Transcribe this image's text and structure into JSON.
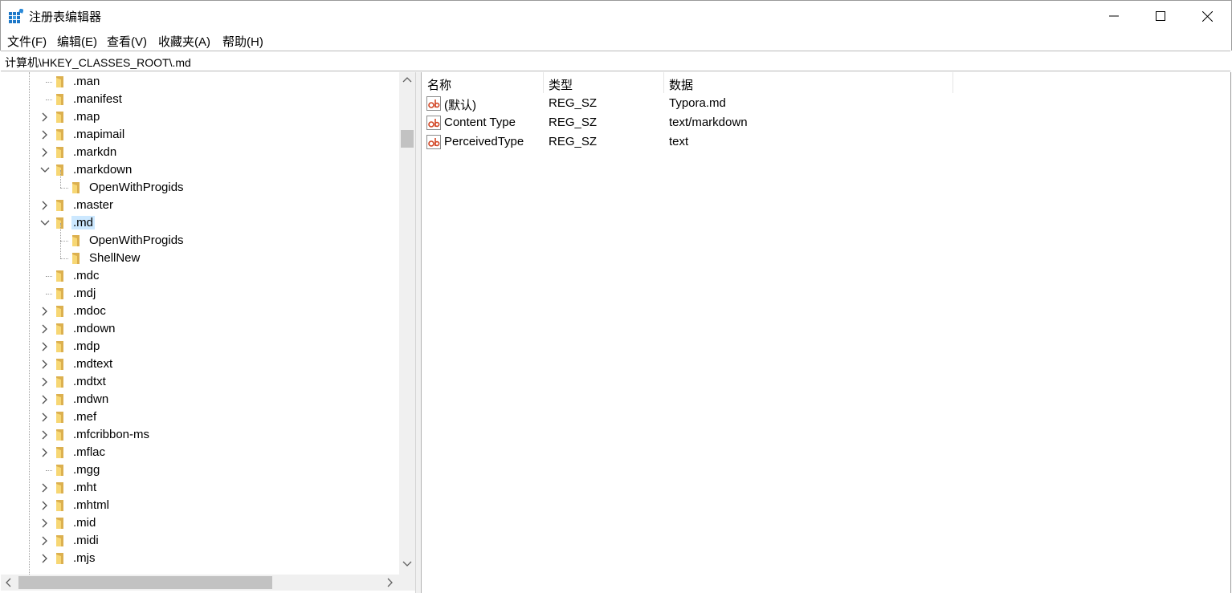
{
  "window": {
    "title": "注册表编辑器"
  },
  "menu": [
    "文件(F)",
    "编辑(E)",
    "查看(V)",
    "收藏夹(A)",
    "帮助(H)"
  ],
  "address": "计算机\\HKEY_CLASSES_ROOT\\.md",
  "tree": {
    "rows": [
      {
        "label": ".man",
        "expander": "none",
        "level": 1
      },
      {
        "label": ".manifest",
        "expander": "none",
        "level": 1
      },
      {
        "label": ".map",
        "expander": "collapsed",
        "level": 1
      },
      {
        "label": ".mapimail",
        "expander": "collapsed",
        "level": 1
      },
      {
        "label": ".markdn",
        "expander": "collapsed",
        "level": 1
      },
      {
        "label": ".markdown",
        "expander": "expanded",
        "level": 1
      },
      {
        "label": "OpenWithProgids",
        "expander": "none",
        "level": 2
      },
      {
        "label": ".master",
        "expander": "collapsed",
        "level": 1
      },
      {
        "label": ".md",
        "expander": "expanded",
        "level": 1,
        "selected": true
      },
      {
        "label": "OpenWithProgids",
        "expander": "none",
        "level": 2
      },
      {
        "label": "ShellNew",
        "expander": "none",
        "level": 2
      },
      {
        "label": ".mdc",
        "expander": "none",
        "level": 1
      },
      {
        "label": ".mdj",
        "expander": "none",
        "level": 1
      },
      {
        "label": ".mdoc",
        "expander": "collapsed",
        "level": 1
      },
      {
        "label": ".mdown",
        "expander": "collapsed",
        "level": 1
      },
      {
        "label": ".mdp",
        "expander": "collapsed",
        "level": 1
      },
      {
        "label": ".mdtext",
        "expander": "collapsed",
        "level": 1
      },
      {
        "label": ".mdtxt",
        "expander": "collapsed",
        "level": 1
      },
      {
        "label": ".mdwn",
        "expander": "collapsed",
        "level": 1
      },
      {
        "label": ".mef",
        "expander": "collapsed",
        "level": 1
      },
      {
        "label": ".mfcribbon-ms",
        "expander": "collapsed",
        "level": 1
      },
      {
        "label": ".mflac",
        "expander": "collapsed",
        "level": 1
      },
      {
        "label": ".mgg",
        "expander": "none",
        "level": 1
      },
      {
        "label": ".mht",
        "expander": "collapsed",
        "level": 1
      },
      {
        "label": ".mhtml",
        "expander": "collapsed",
        "level": 1
      },
      {
        "label": ".mid",
        "expander": "collapsed",
        "level": 1
      },
      {
        "label": ".midi",
        "expander": "collapsed",
        "level": 1
      },
      {
        "label": ".mjs",
        "expander": "collapsed",
        "level": 1
      }
    ]
  },
  "values": {
    "headers": [
      "名称",
      "类型",
      "数据"
    ],
    "rows": [
      {
        "name": "(默认)",
        "type": "REG_SZ",
        "data": "Typora.md",
        "icon": "string-value-icon"
      },
      {
        "name": "Content Type",
        "type": "REG_SZ",
        "data": "text/markdown",
        "icon": "string-value-icon"
      },
      {
        "name": "PerceivedType",
        "type": "REG_SZ",
        "data": "text",
        "icon": "string-value-icon"
      }
    ]
  }
}
